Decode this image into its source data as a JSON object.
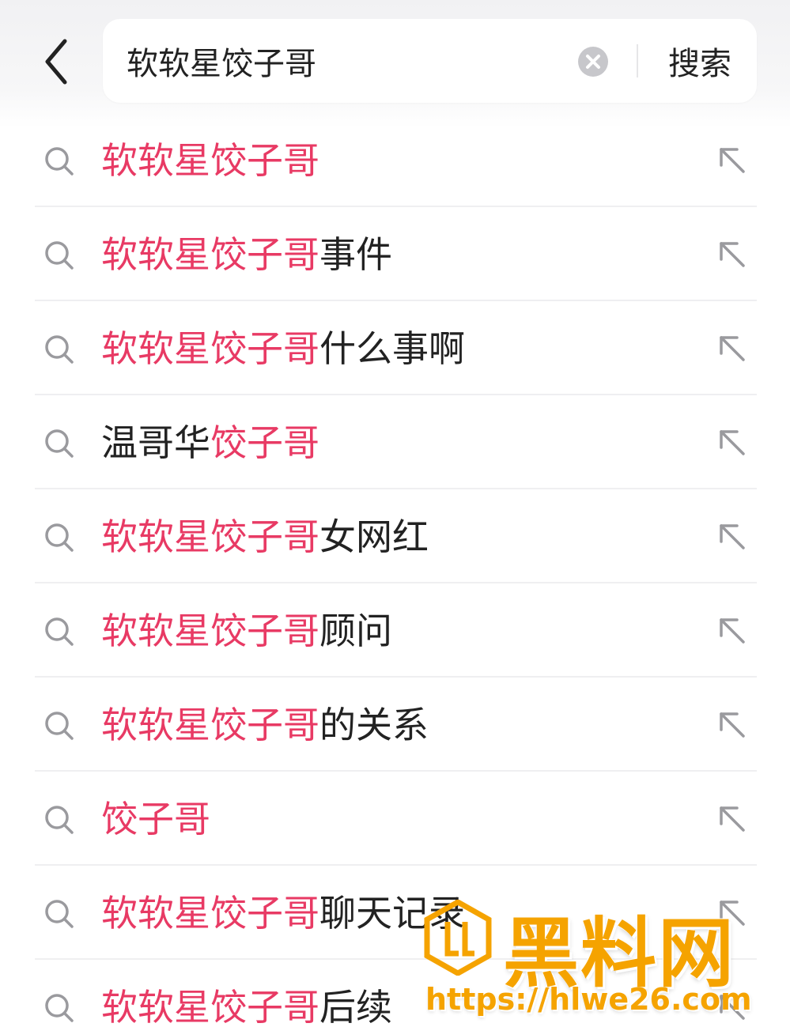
{
  "search": {
    "query": "软软星饺子哥",
    "button_label": "搜索"
  },
  "suggestions": [
    {
      "parts": [
        {
          "t": "软软星饺子哥",
          "hl": true
        }
      ]
    },
    {
      "parts": [
        {
          "t": "软软星饺子哥",
          "hl": true
        },
        {
          "t": "事件",
          "hl": false
        }
      ]
    },
    {
      "parts": [
        {
          "t": "软软星饺子哥",
          "hl": true
        },
        {
          "t": "什么事啊",
          "hl": false
        }
      ]
    },
    {
      "parts": [
        {
          "t": "温哥华",
          "hl": false
        },
        {
          "t": "饺子哥",
          "hl": true
        }
      ]
    },
    {
      "parts": [
        {
          "t": "软软星饺子哥",
          "hl": true
        },
        {
          "t": "女网红",
          "hl": false
        }
      ]
    },
    {
      "parts": [
        {
          "t": "软软星饺子哥",
          "hl": true
        },
        {
          "t": "顾问",
          "hl": false
        }
      ]
    },
    {
      "parts": [
        {
          "t": "软软星饺子哥",
          "hl": true
        },
        {
          "t": "的关系",
          "hl": false
        }
      ]
    },
    {
      "parts": [
        {
          "t": "饺子哥",
          "hl": true
        }
      ]
    },
    {
      "parts": [
        {
          "t": "软软星饺子哥",
          "hl": true
        },
        {
          "t": "聊天记录",
          "hl": false
        }
      ]
    },
    {
      "parts": [
        {
          "t": "软软星饺子哥",
          "hl": true
        },
        {
          "t": "后续",
          "hl": false
        }
      ]
    }
  ],
  "watermark": {
    "title": "黑料网",
    "url": "https://hlwe26.com"
  },
  "colors": {
    "highlight": "#e83a64",
    "text": "#222222",
    "icon_gray": "#9a9a9e",
    "watermark": "#f5a300"
  },
  "icons": {
    "back": "chevron-left-icon",
    "clear": "clear-circle-icon",
    "search": "search-icon",
    "fill": "arrow-up-left-icon"
  }
}
